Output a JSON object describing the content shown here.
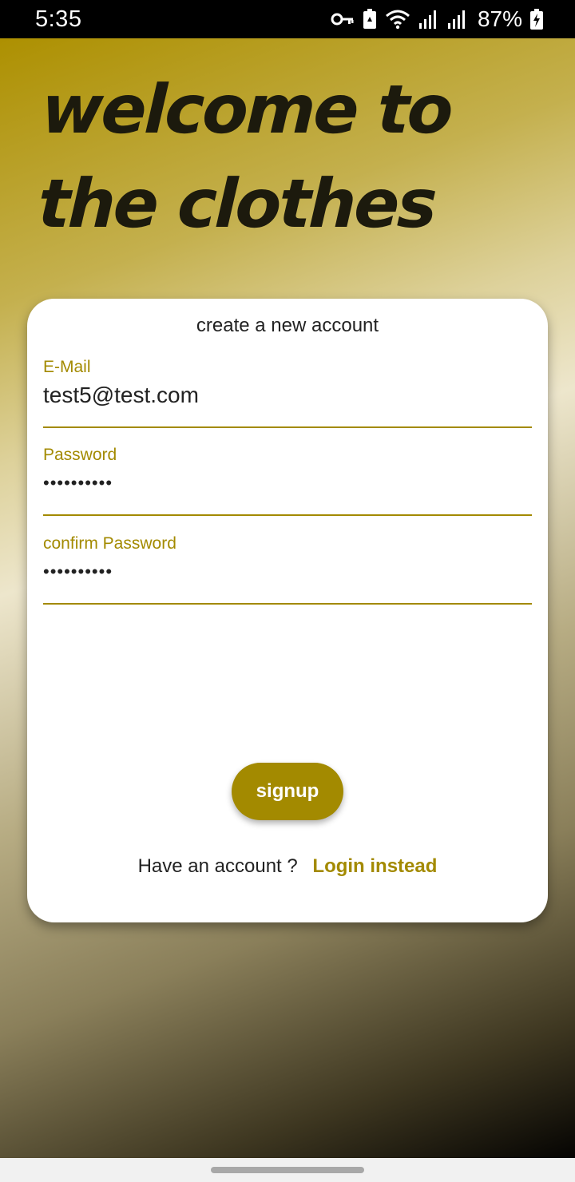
{
  "status_bar": {
    "time": "5:35",
    "battery_percent": "87%",
    "icons": [
      "key-icon",
      "battery-saver-icon",
      "wifi-icon",
      "signal-icon",
      "signal-icon",
      "battery-charging-icon"
    ]
  },
  "header": {
    "title_line1": "welcome to",
    "title_line2": "the clothes"
  },
  "form": {
    "title": "create a new account",
    "email": {
      "label": "E-Mail",
      "value": "test5@test.com"
    },
    "password": {
      "label": "Password",
      "value": "••••••••••"
    },
    "confirm_password": {
      "label": "confirm Password",
      "value": "••••••••••"
    },
    "signup_label": "signup",
    "switch_text": "Have an account ?",
    "switch_link": "Login instead"
  },
  "colors": {
    "accent": "#a38a00",
    "card_bg": "#ffffff",
    "title_color": "#1c1a0d"
  }
}
